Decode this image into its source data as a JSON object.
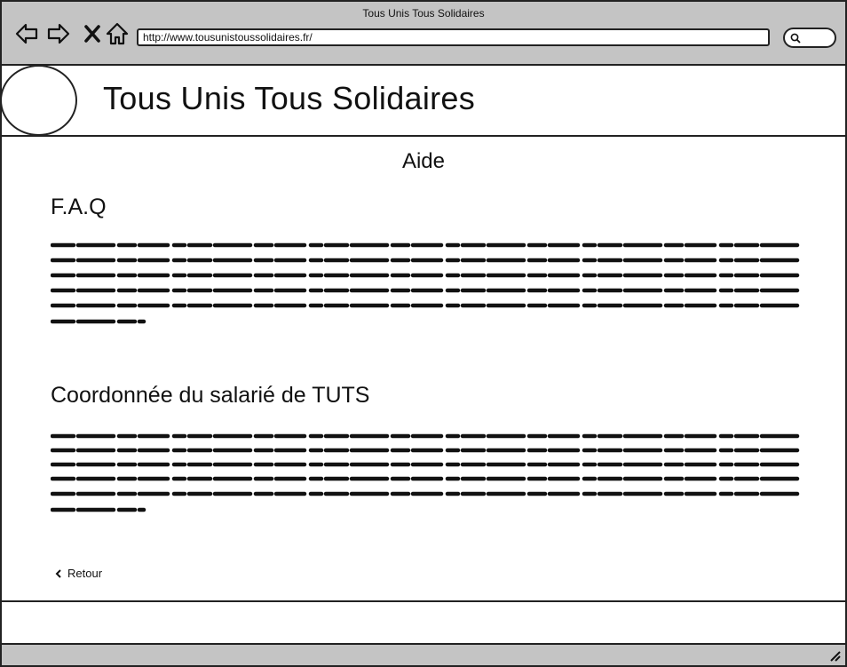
{
  "browser": {
    "window_title": "Tous Unis Tous Solidaires",
    "url": "http://www.tousunistoussolidaires.fr/",
    "nav_icons": [
      "back-arrow-icon",
      "forward-arrow-icon",
      "stop-icon",
      "home-icon"
    ],
    "search_icon": "search-icon"
  },
  "header": {
    "site_title": "Tous Unis Tous Solidaires"
  },
  "main": {
    "page_heading": "Aide",
    "sections": [
      {
        "title": "F.A.Q"
      },
      {
        "title": "Coordonnée du salarié de TUTS"
      }
    ],
    "back_label": "Retour"
  },
  "colors": {
    "chrome": "#c4c4c4",
    "border": "#222222",
    "background": "#ffffff"
  }
}
